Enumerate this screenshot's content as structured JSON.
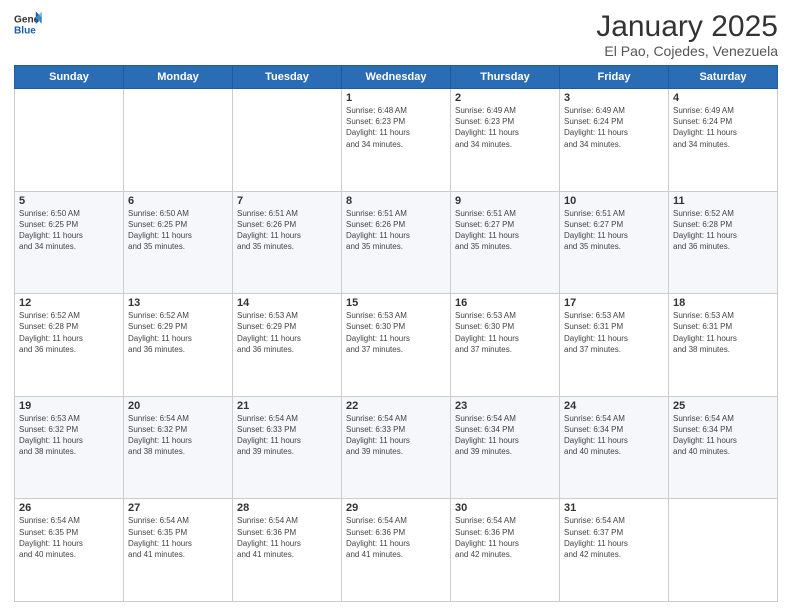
{
  "header": {
    "logo_line1": "General",
    "logo_line2": "Blue",
    "title": "January 2025",
    "subtitle": "El Pao, Cojedes, Venezuela"
  },
  "weekdays": [
    "Sunday",
    "Monday",
    "Tuesday",
    "Wednesday",
    "Thursday",
    "Friday",
    "Saturday"
  ],
  "weeks": [
    [
      {
        "day": "",
        "info": ""
      },
      {
        "day": "",
        "info": ""
      },
      {
        "day": "",
        "info": ""
      },
      {
        "day": "1",
        "info": "Sunrise: 6:48 AM\nSunset: 6:23 PM\nDaylight: 11 hours\nand 34 minutes."
      },
      {
        "day": "2",
        "info": "Sunrise: 6:49 AM\nSunset: 6:23 PM\nDaylight: 11 hours\nand 34 minutes."
      },
      {
        "day": "3",
        "info": "Sunrise: 6:49 AM\nSunset: 6:24 PM\nDaylight: 11 hours\nand 34 minutes."
      },
      {
        "day": "4",
        "info": "Sunrise: 6:49 AM\nSunset: 6:24 PM\nDaylight: 11 hours\nand 34 minutes."
      }
    ],
    [
      {
        "day": "5",
        "info": "Sunrise: 6:50 AM\nSunset: 6:25 PM\nDaylight: 11 hours\nand 34 minutes."
      },
      {
        "day": "6",
        "info": "Sunrise: 6:50 AM\nSunset: 6:25 PM\nDaylight: 11 hours\nand 35 minutes."
      },
      {
        "day": "7",
        "info": "Sunrise: 6:51 AM\nSunset: 6:26 PM\nDaylight: 11 hours\nand 35 minutes."
      },
      {
        "day": "8",
        "info": "Sunrise: 6:51 AM\nSunset: 6:26 PM\nDaylight: 11 hours\nand 35 minutes."
      },
      {
        "day": "9",
        "info": "Sunrise: 6:51 AM\nSunset: 6:27 PM\nDaylight: 11 hours\nand 35 minutes."
      },
      {
        "day": "10",
        "info": "Sunrise: 6:51 AM\nSunset: 6:27 PM\nDaylight: 11 hours\nand 35 minutes."
      },
      {
        "day": "11",
        "info": "Sunrise: 6:52 AM\nSunset: 6:28 PM\nDaylight: 11 hours\nand 36 minutes."
      }
    ],
    [
      {
        "day": "12",
        "info": "Sunrise: 6:52 AM\nSunset: 6:28 PM\nDaylight: 11 hours\nand 36 minutes."
      },
      {
        "day": "13",
        "info": "Sunrise: 6:52 AM\nSunset: 6:29 PM\nDaylight: 11 hours\nand 36 minutes."
      },
      {
        "day": "14",
        "info": "Sunrise: 6:53 AM\nSunset: 6:29 PM\nDaylight: 11 hours\nand 36 minutes."
      },
      {
        "day": "15",
        "info": "Sunrise: 6:53 AM\nSunset: 6:30 PM\nDaylight: 11 hours\nand 37 minutes."
      },
      {
        "day": "16",
        "info": "Sunrise: 6:53 AM\nSunset: 6:30 PM\nDaylight: 11 hours\nand 37 minutes."
      },
      {
        "day": "17",
        "info": "Sunrise: 6:53 AM\nSunset: 6:31 PM\nDaylight: 11 hours\nand 37 minutes."
      },
      {
        "day": "18",
        "info": "Sunrise: 6:53 AM\nSunset: 6:31 PM\nDaylight: 11 hours\nand 38 minutes."
      }
    ],
    [
      {
        "day": "19",
        "info": "Sunrise: 6:53 AM\nSunset: 6:32 PM\nDaylight: 11 hours\nand 38 minutes."
      },
      {
        "day": "20",
        "info": "Sunrise: 6:54 AM\nSunset: 6:32 PM\nDaylight: 11 hours\nand 38 minutes."
      },
      {
        "day": "21",
        "info": "Sunrise: 6:54 AM\nSunset: 6:33 PM\nDaylight: 11 hours\nand 39 minutes."
      },
      {
        "day": "22",
        "info": "Sunrise: 6:54 AM\nSunset: 6:33 PM\nDaylight: 11 hours\nand 39 minutes."
      },
      {
        "day": "23",
        "info": "Sunrise: 6:54 AM\nSunset: 6:34 PM\nDaylight: 11 hours\nand 39 minutes."
      },
      {
        "day": "24",
        "info": "Sunrise: 6:54 AM\nSunset: 6:34 PM\nDaylight: 11 hours\nand 40 minutes."
      },
      {
        "day": "25",
        "info": "Sunrise: 6:54 AM\nSunset: 6:34 PM\nDaylight: 11 hours\nand 40 minutes."
      }
    ],
    [
      {
        "day": "26",
        "info": "Sunrise: 6:54 AM\nSunset: 6:35 PM\nDaylight: 11 hours\nand 40 minutes."
      },
      {
        "day": "27",
        "info": "Sunrise: 6:54 AM\nSunset: 6:35 PM\nDaylight: 11 hours\nand 41 minutes."
      },
      {
        "day": "28",
        "info": "Sunrise: 6:54 AM\nSunset: 6:36 PM\nDaylight: 11 hours\nand 41 minutes."
      },
      {
        "day": "29",
        "info": "Sunrise: 6:54 AM\nSunset: 6:36 PM\nDaylight: 11 hours\nand 41 minutes."
      },
      {
        "day": "30",
        "info": "Sunrise: 6:54 AM\nSunset: 6:36 PM\nDaylight: 11 hours\nand 42 minutes."
      },
      {
        "day": "31",
        "info": "Sunrise: 6:54 AM\nSunset: 6:37 PM\nDaylight: 11 hours\nand 42 minutes."
      },
      {
        "day": "",
        "info": ""
      }
    ]
  ]
}
